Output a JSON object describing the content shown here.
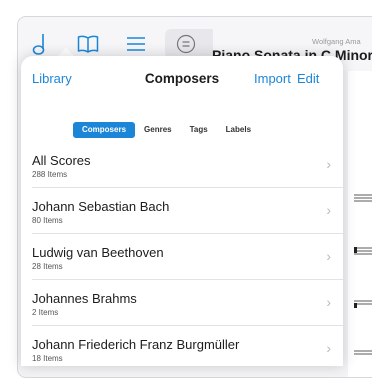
{
  "toolbar": {
    "icons": [
      "music-note-icon",
      "book-icon",
      "list-icon",
      "tuning-icon"
    ],
    "composer_label": "Wolfgang Ama",
    "score_title": "Piano Sonata in C Minor,"
  },
  "popover": {
    "nav": {
      "library": "Library",
      "title": "Composers",
      "import": "Import",
      "edit": "Edit"
    },
    "segments": [
      {
        "label": "Composers",
        "active": true
      },
      {
        "label": "Genres",
        "active": false
      },
      {
        "label": "Tags",
        "active": false
      },
      {
        "label": "Labels",
        "active": false
      }
    ],
    "rows": [
      {
        "title": "All Scores",
        "subtitle": "288 Items"
      },
      {
        "title": "Johann Sebastian Bach",
        "subtitle": "80 Items"
      },
      {
        "title": "Ludwig van Beethoven",
        "subtitle": "28 Items"
      },
      {
        "title": "Johannes Brahms",
        "subtitle": "2 Items"
      },
      {
        "title": "Johann Friederich Franz Burgmüller",
        "subtitle": "18 Items"
      }
    ]
  },
  "colors": {
    "accent": "#1b86d8",
    "text": "#1d1d1f",
    "chevron": "#b8b8bc"
  }
}
